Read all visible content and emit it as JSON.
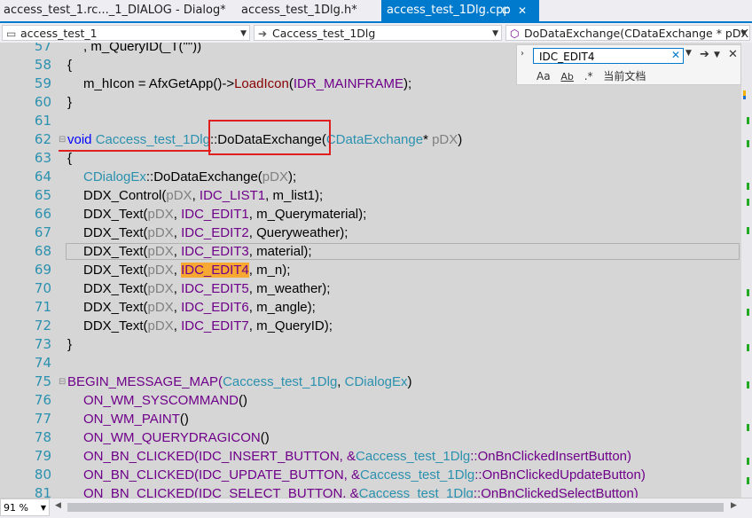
{
  "tabs": [
    {
      "label": "access_test_1.rc..._1_DIALOG - Dialog*"
    },
    {
      "label": "access_test_1Dlg.h*"
    },
    {
      "label": "access_test_1Dlg.cpp",
      "pin": "⊏",
      "close": "✕"
    }
  ],
  "nav": {
    "project": "access_test_1",
    "class": "Caccess_test_1Dlg",
    "member": "DoDataExchange(CDataExchange * pDX)"
  },
  "find": {
    "value": "IDC_EDIT4",
    "scope": "当前文档",
    "match_case": "Aa",
    "whole_word": "Ab"
  },
  "lines": [
    {
      "n": "57"
    },
    {
      "n": "58"
    },
    {
      "n": "59"
    },
    {
      "n": "60"
    },
    {
      "n": "61"
    },
    {
      "n": "62"
    },
    {
      "n": "63"
    },
    {
      "n": "64"
    },
    {
      "n": "65"
    },
    {
      "n": "66"
    },
    {
      "n": "67"
    },
    {
      "n": "68"
    },
    {
      "n": "69"
    },
    {
      "n": "70"
    },
    {
      "n": "71"
    },
    {
      "n": "72"
    },
    {
      "n": "73"
    },
    {
      "n": "74"
    },
    {
      "n": "75"
    },
    {
      "n": "76"
    },
    {
      "n": "77"
    },
    {
      "n": "78"
    },
    {
      "n": "79"
    },
    {
      "n": "80"
    },
    {
      "n": "81"
    }
  ],
  "code": {
    "l57": ", m_QueryID(_T(\"\"))",
    "l58": "{",
    "l59a": "m_hIcon = AfxGetApp()->",
    "l59b": "LoadIcon",
    "l59c": "(",
    "l59d": "IDR_MAINFRAME",
    "l59e": ");",
    "l60": "}",
    "l62a": "void",
    "l62b": "Caccess_test_1Dlg",
    "l62c": "::DoDataExchange(",
    "l62d": "CDataExchange",
    "l62e": "* ",
    "l62f": "pDX",
    "l62g": ")",
    "l63": "{",
    "l64a": "CDialogEx",
    "l64b": "::DoDataExchange(",
    "l64c": "pDX",
    "l64d": ");",
    "l65a": "DDX_Control(",
    "l65b": "pDX",
    "l65c": ", ",
    "l65d": "IDC_LIST1",
    "l65e": ", m_list1);",
    "l66": {
      "a": "DDX_Text(",
      "b": "pDX",
      "c": ", ",
      "d": "IDC_EDIT1",
      "e": ", m_Querymaterial);"
    },
    "l67": {
      "a": "DDX_Text(",
      "b": "pDX",
      "c": ", ",
      "d": "IDC_EDIT2",
      "e": ", Queryweather);"
    },
    "l68": {
      "a": "DDX_Text(",
      "b": "pDX",
      "c": ", ",
      "d": "IDC_EDIT3",
      "e": ", material);"
    },
    "l69": {
      "a": "DDX_Text(",
      "b": "pDX",
      "c": ", ",
      "d": "IDC_EDIT4",
      "e": ", m_n);"
    },
    "l70": {
      "a": "DDX_Text(",
      "b": "pDX",
      "c": ", ",
      "d": "IDC_EDIT5",
      "e": ", m_weather);"
    },
    "l71": {
      "a": "DDX_Text(",
      "b": "pDX",
      "c": ", ",
      "d": "IDC_EDIT6",
      "e": ", m_angle);"
    },
    "l72": {
      "a": "DDX_Text(",
      "b": "pDX",
      "c": ", ",
      "d": "IDC_EDIT7",
      "e": ", m_QueryID);"
    },
    "l73": "}",
    "l75a": "BEGIN_MESSAGE_MAP(",
    "l75b": "Caccess_test_1Dlg",
    "l75c": ", ",
    "l75d": "CDialogEx",
    "l75e": ")",
    "l76": "ON_WM_SYSCOMMAND",
    "l77": "ON_WM_PAINT",
    "l78": "ON_WM_QUERYDRAGICON",
    "l79": {
      "a": "ON_BN_CLICKED(IDC_INSERT_BUTTON, &",
      "b": "Caccess_test_1Dlg",
      "c": "::OnBnClickedInsertButton)"
    },
    "l80": {
      "a": "ON_BN_CLICKED(IDC_UPDATE_BUTTON, &",
      "b": "Caccess_test_1Dlg",
      "c": "::OnBnClickedUpdateButton)"
    },
    "l81": {
      "a": "ON_BN_CLICKED(IDC_SELECT_BUTTON, &",
      "b": "Caccess_test_1Dlg",
      "c": "::OnBnClickedSelectButton)"
    },
    "parens": "()"
  },
  "status": {
    "zoom": "91 %"
  },
  "colors": {
    "accent": "#007acc",
    "keyword": "#0000ff",
    "type": "#2b91af",
    "macro": "#6f008a",
    "annotation": "#e02020",
    "find_highlight": "#f7a833"
  }
}
